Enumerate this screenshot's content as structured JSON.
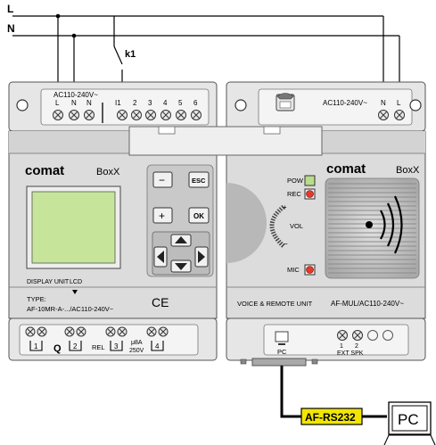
{
  "wires": {
    "l": "L",
    "n": "N",
    "contact": "k1"
  },
  "left_unit": {
    "terminal_title": "AC110-240V~",
    "terminal_labels": [
      "L",
      "N",
      "N",
      "I1",
      "2",
      "3",
      "4",
      "5",
      "6"
    ],
    "brand": "comat",
    "model": "BoxX",
    "display_caption": "DISPLAY UNIT",
    "lcd_label": "LCD",
    "type_label": "TYPE:",
    "type_value": "AF-10MR-A-.../AC110-240V~",
    "ce_mark": "CE",
    "buttons": {
      "minus": "−",
      "esc": "ESC",
      "plus": "+",
      "ok": "OK"
    },
    "outputs": [
      "1",
      "Q",
      "2",
      "REL",
      "3",
      "μ8A",
      "250V",
      "4"
    ]
  },
  "right_unit": {
    "terminal_title": "AC110-240V~",
    "terminal_labels": [
      "N",
      "L"
    ],
    "brand": "comat",
    "model": "BoxX",
    "pow": "POW",
    "rec": "REC",
    "vol": "VOL",
    "vol_plus": "+",
    "vol_minus": "−",
    "mic": "MIC",
    "caption": "VOICE & REMOTE UNIT",
    "model_code": "AF-MUL/AC110-240V~",
    "port_pc": "PC",
    "port_num1": "1",
    "port_num2": "2",
    "port_ext": "EXT SPK"
  },
  "cable": {
    "label": "AF-RS232",
    "accent": "#f2e600"
  },
  "pc": {
    "label": "PC"
  },
  "colors": {
    "housing": "#d9d9d9",
    "lcd": "#c7e59a",
    "speaker": "#bdbdbd",
    "led_green": "#b9dc8a",
    "led_red": "#e23b2a"
  }
}
